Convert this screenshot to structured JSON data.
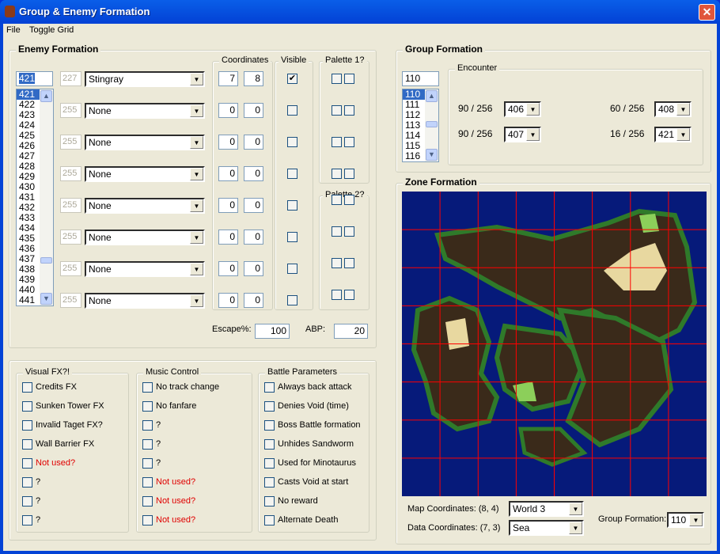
{
  "window": {
    "title": "Group & Enemy Formation",
    "close_label": "✕"
  },
  "menu": [
    "File",
    "Toggle Grid"
  ],
  "enemy_formation": {
    "title": "Enemy Formation",
    "search_value": "421",
    "list": [
      "421",
      "422",
      "423",
      "424",
      "425",
      "426",
      "427",
      "428",
      "429",
      "430",
      "431",
      "432",
      "433",
      "434",
      "435",
      "436",
      "437",
      "438",
      "439",
      "440",
      "441"
    ],
    "selected": "421",
    "coordinates_label": "Coordinates",
    "visible_label": "Visible",
    "palette1_label": "Palette 1?",
    "palette2_label": "Palette 2?",
    "slots": [
      {
        "id": "227",
        "enemy": "Stingray",
        "x": "7",
        "y": "8",
        "visible": true
      },
      {
        "id": "255",
        "enemy": "None",
        "x": "0",
        "y": "0",
        "visible": false
      },
      {
        "id": "255",
        "enemy": "None",
        "x": "0",
        "y": "0",
        "visible": false
      },
      {
        "id": "255",
        "enemy": "None",
        "x": "0",
        "y": "0",
        "visible": false
      },
      {
        "id": "255",
        "enemy": "None",
        "x": "0",
        "y": "0",
        "visible": false
      },
      {
        "id": "255",
        "enemy": "None",
        "x": "0",
        "y": "0",
        "visible": false
      },
      {
        "id": "255",
        "enemy": "None",
        "x": "0",
        "y": "0",
        "visible": false
      },
      {
        "id": "255",
        "enemy": "None",
        "x": "0",
        "y": "0",
        "visible": false
      }
    ],
    "escape_label": "Escape%:",
    "escape_value": "100",
    "abp_label": "ABP:",
    "abp_value": "20"
  },
  "visual_fx": {
    "title": "Visual FX?!",
    "items": [
      {
        "label": "Credits FX",
        "red": false
      },
      {
        "label": "Sunken Tower FX",
        "red": false
      },
      {
        "label": "Invalid Taget FX?",
        "red": false
      },
      {
        "label": "Wall Barrier FX",
        "red": false
      },
      {
        "label": "Not used?",
        "red": true
      },
      {
        "label": "?",
        "red": false
      },
      {
        "label": "?",
        "red": false
      },
      {
        "label": "?",
        "red": false
      }
    ]
  },
  "music_control": {
    "title": "Music Control",
    "items": [
      {
        "label": "No track change",
        "red": false
      },
      {
        "label": "No fanfare",
        "red": false
      },
      {
        "label": "?",
        "red": false
      },
      {
        "label": "?",
        "red": false
      },
      {
        "label": "?",
        "red": false
      },
      {
        "label": "Not used?",
        "red": true
      },
      {
        "label": "Not used?",
        "red": true
      },
      {
        "label": "Not used?",
        "red": true
      }
    ]
  },
  "battle_parameters": {
    "title": "Battle Parameters",
    "items": [
      {
        "label": "Always back attack",
        "red": false
      },
      {
        "label": "Denies Void (time)",
        "red": false
      },
      {
        "label": "Boss Battle formation",
        "red": false
      },
      {
        "label": "Unhides Sandworm",
        "red": false
      },
      {
        "label": "Used for Minotaurus",
        "red": false
      },
      {
        "label": "Casts Void at start",
        "red": false
      },
      {
        "label": "No reward",
        "red": false
      },
      {
        "label": "Alternate Death",
        "red": false
      }
    ]
  },
  "group_formation": {
    "title": "Group Formation",
    "search_value": "110",
    "list": [
      "110",
      "111",
      "112",
      "113",
      "114",
      "115",
      "116"
    ],
    "selected": "110",
    "encounter_title": "Encounter",
    "encounters": [
      {
        "rate": "90 / 256",
        "value": "406"
      },
      {
        "rate": "60 / 256",
        "value": "408"
      },
      {
        "rate": "90 / 256",
        "value": "407"
      },
      {
        "rate": "16 / 256",
        "value": "421"
      }
    ]
  },
  "zone_formation": {
    "title": "Zone Formation",
    "map_coords_label": "Map Coordinates: (8, 4)",
    "data_coords_label": "Data Coordinates: (7, 3)",
    "world_value": "World 3",
    "terrain_value": "Sea",
    "group_formation_label": "Group Formation:",
    "group_formation_value": "110",
    "grid_divisions": 8,
    "grid_color": "#ff0000",
    "sea_color": "#061a7a"
  }
}
